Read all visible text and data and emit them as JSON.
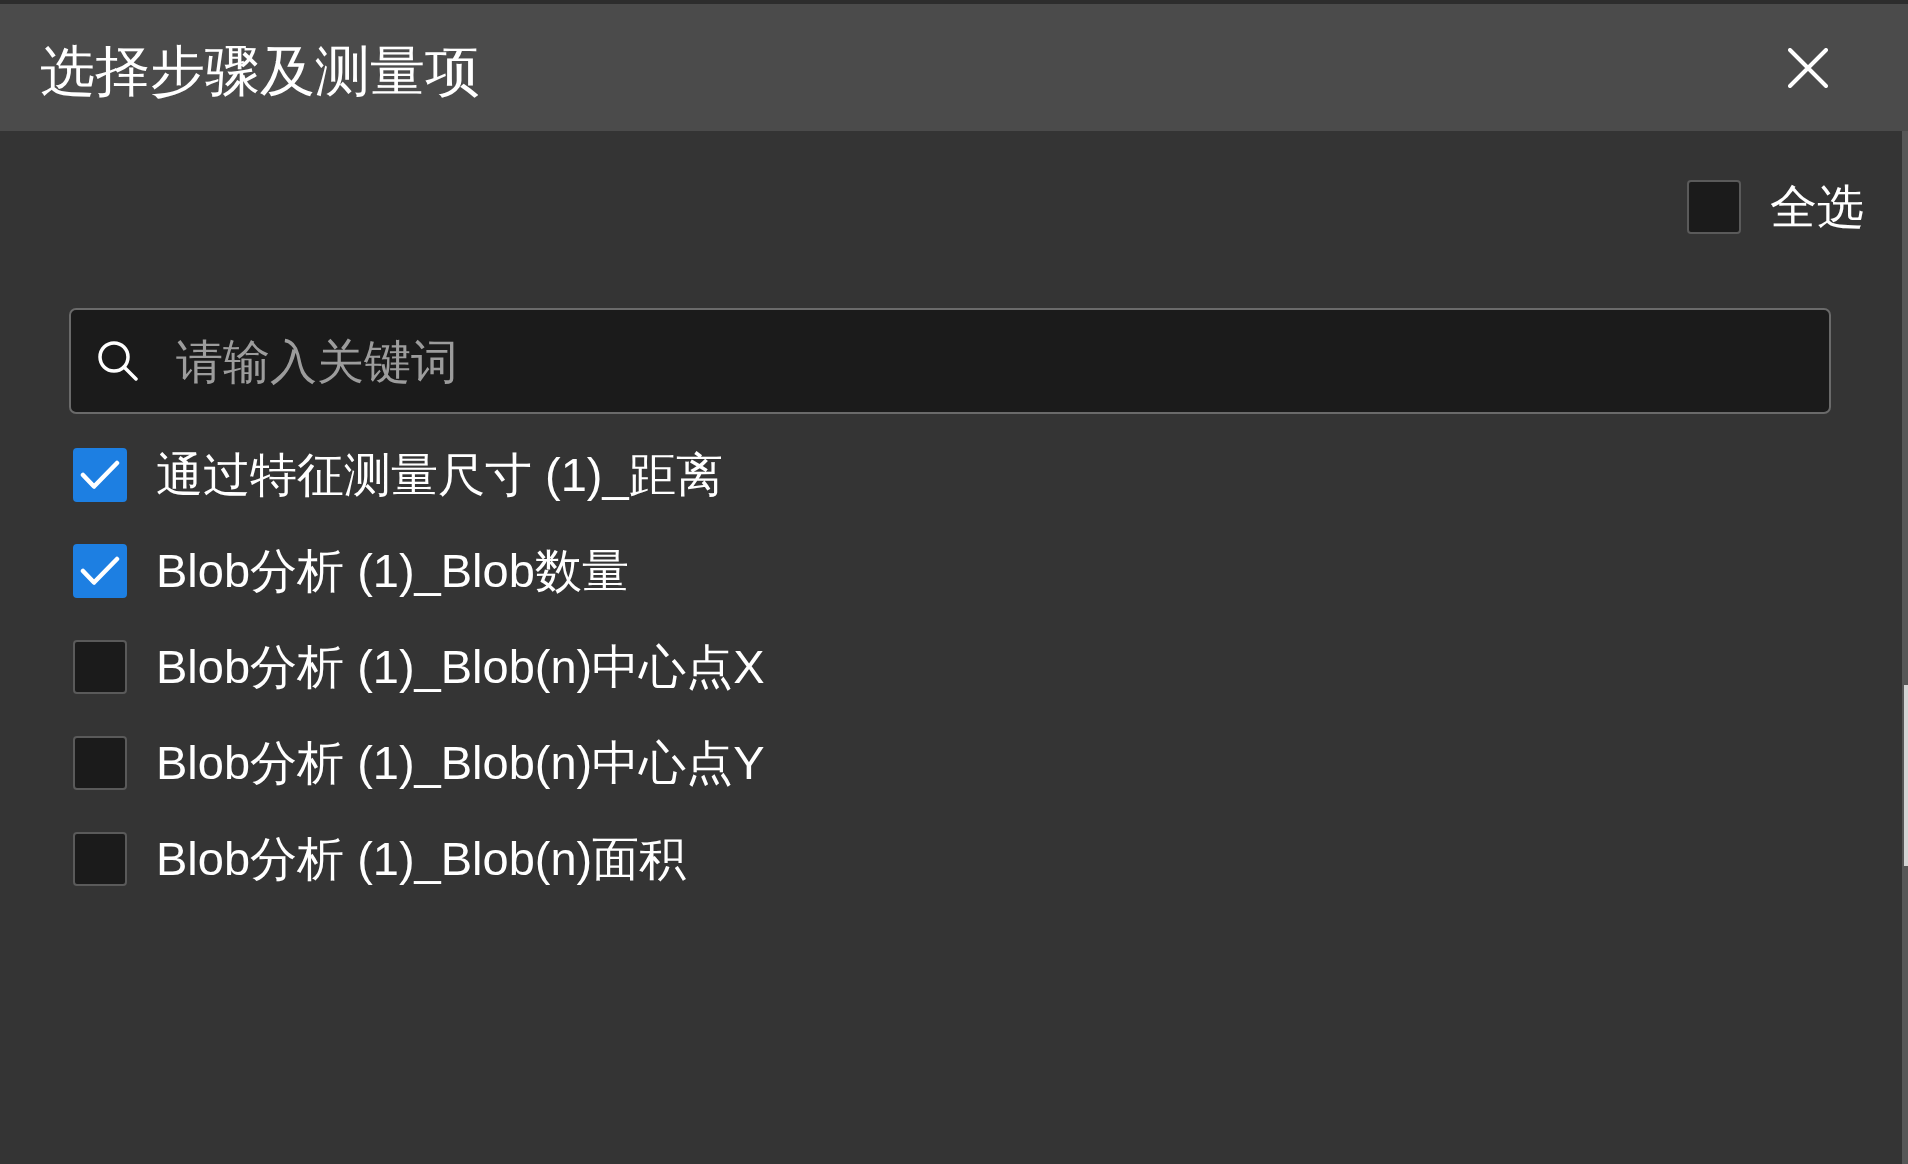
{
  "dialog": {
    "title": "选择步骤及测量项"
  },
  "select_all": {
    "label": "全选",
    "checked": false
  },
  "search": {
    "placeholder": "请输入关键词"
  },
  "items": [
    {
      "label": "通过特征测量尺寸 (1)_距离",
      "checked": true
    },
    {
      "label": "Blob分析 (1)_Blob数量",
      "checked": true
    },
    {
      "label": "Blob分析 (1)_Blob(n)中心点X",
      "checked": false
    },
    {
      "label": "Blob分析 (1)_Blob(n)中心点Y",
      "checked": false
    },
    {
      "label": "Blob分析 (1)_Blob(n)面积",
      "checked": false
    }
  ]
}
